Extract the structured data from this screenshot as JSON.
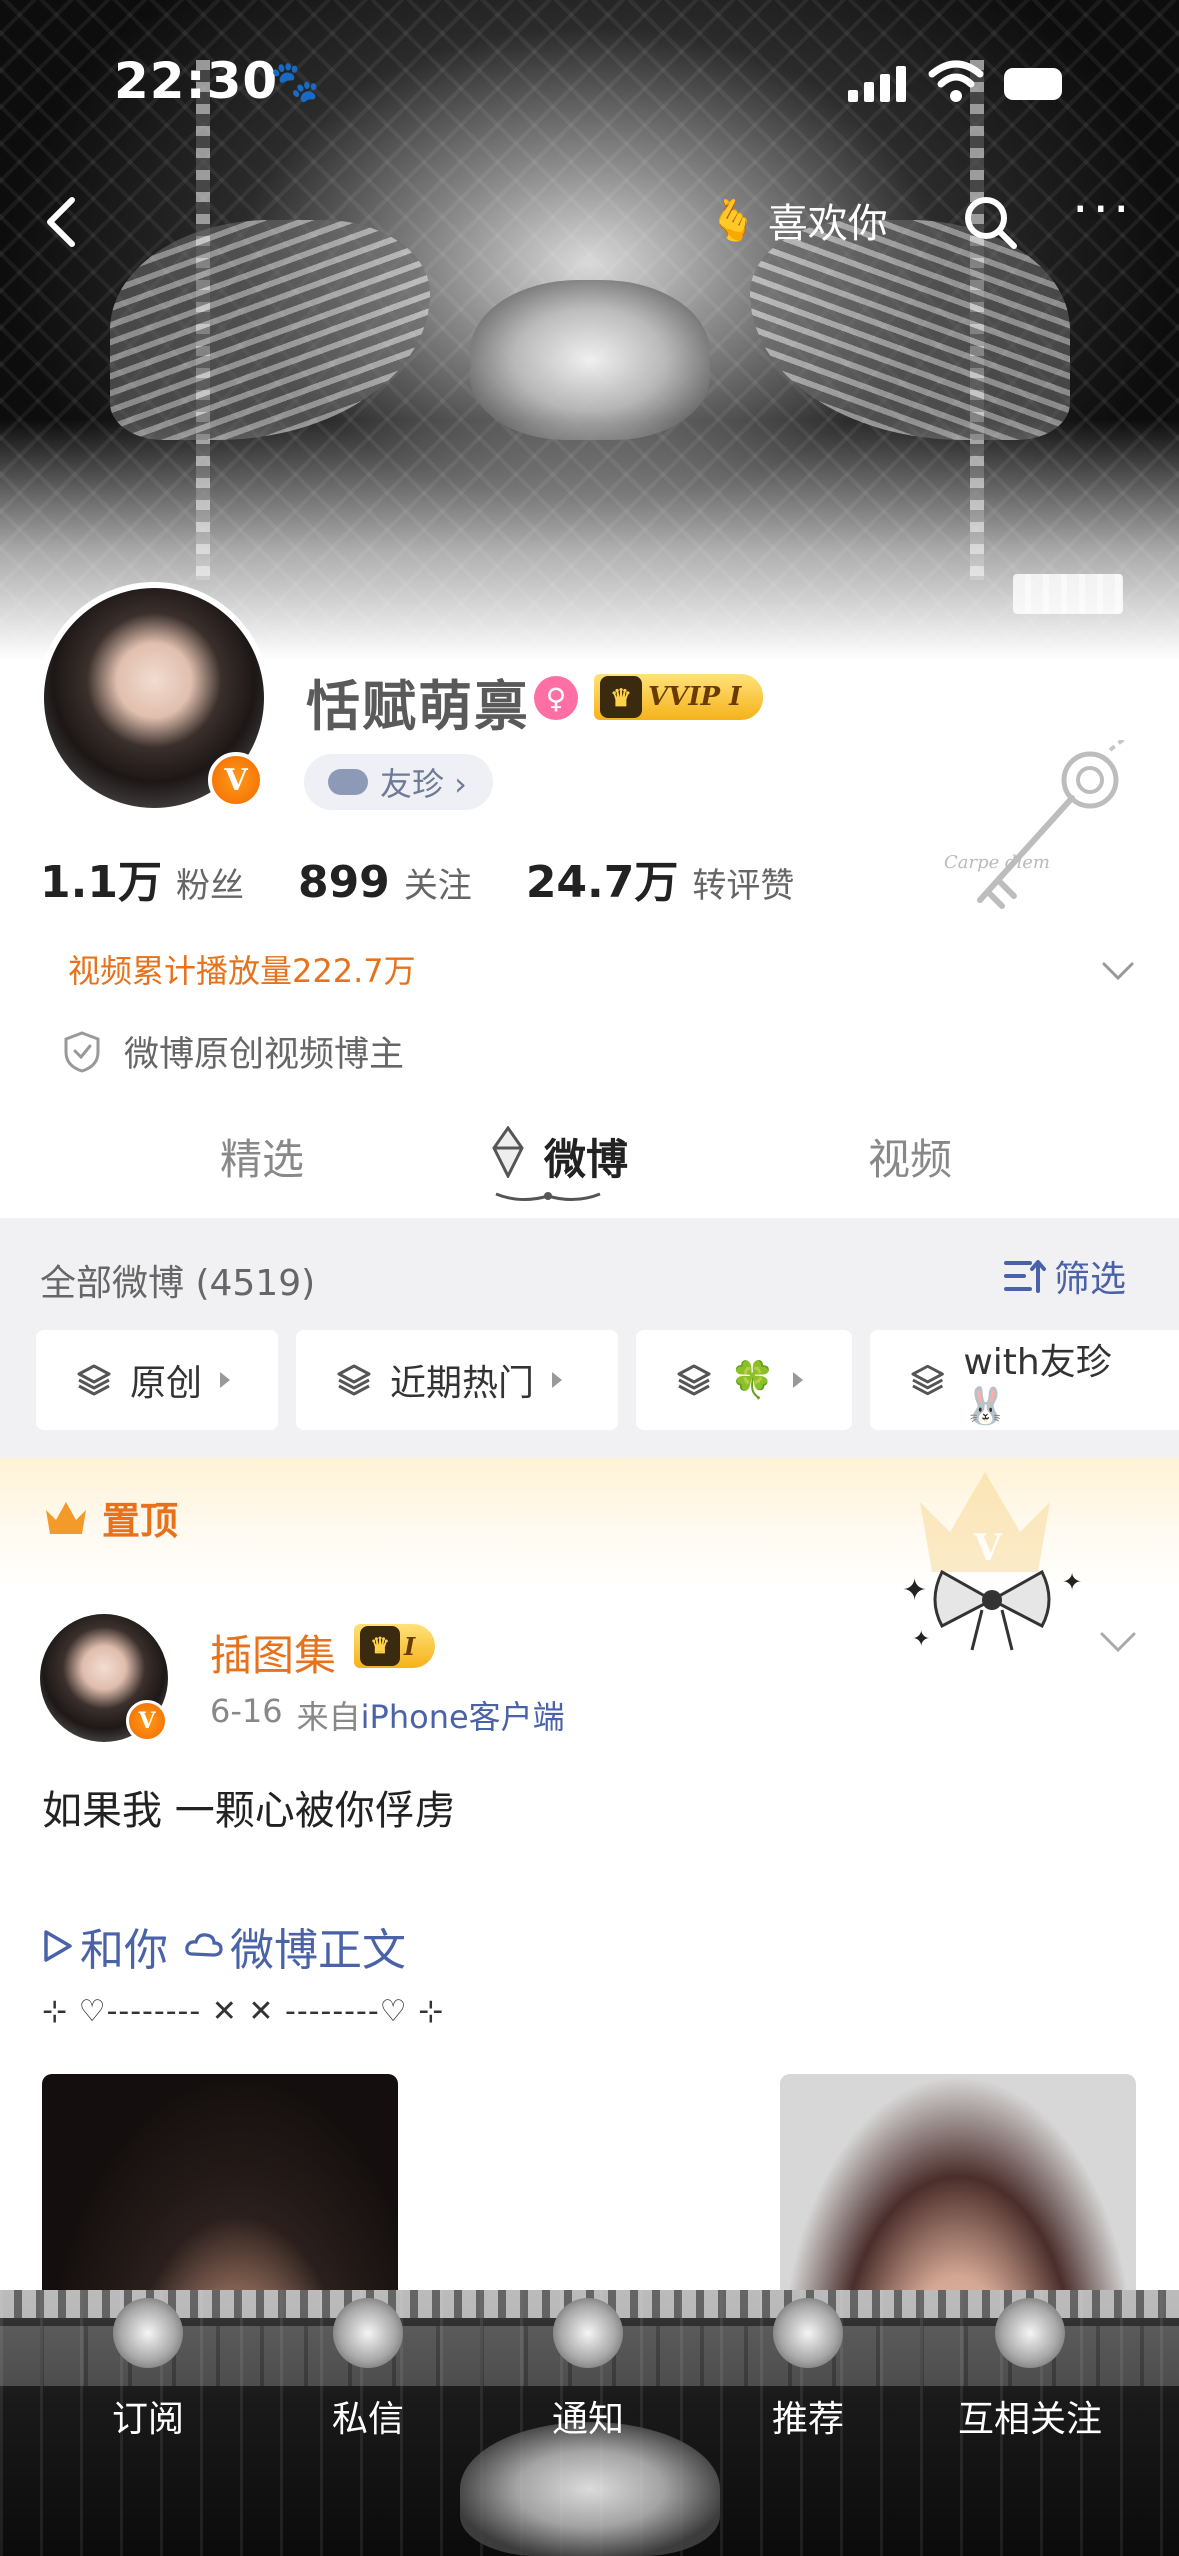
{
  "status_bar": {
    "time": "22:30"
  },
  "nav": {
    "like_label": "喜欢你"
  },
  "profile": {
    "username": "恬赋萌禀",
    "vip_label": "VVIP I",
    "fan_group": "友珍 ›",
    "stats": [
      {
        "value": "1.1万",
        "label": "粉丝"
      },
      {
        "value": "899",
        "label": "关注"
      },
      {
        "value": "24.7万",
        "label": "转评赞"
      }
    ],
    "video_views": "视频累计播放量222.7万",
    "certification": "微博原创视频博主",
    "deco_text": "Carpe diem"
  },
  "tabs": [
    {
      "label": "精选",
      "active": false
    },
    {
      "label": "微博",
      "active": true
    },
    {
      "label": "视频",
      "active": false
    }
  ],
  "feed": {
    "all_count": "全部微博 (4519)",
    "filter_label": "筛选",
    "chips": [
      {
        "label": "原创"
      },
      {
        "label": "近期热门"
      },
      {
        "label": "🍀"
      },
      {
        "label": "with友珍🐰"
      }
    ]
  },
  "pinned": {
    "label": "置顶"
  },
  "post": {
    "author": "插图集",
    "medal": "I",
    "date": "6-16",
    "source_prefix": "来自",
    "source": "iPhone客户端",
    "text": "如果我 一颗心被你俘虏",
    "links": [
      {
        "icon": "play-icon",
        "label": "和你"
      },
      {
        "icon": "weibo-icon",
        "label": "微博正文"
      }
    ],
    "deco_line": "⊹ ♡-------- ✕ ✕ --------♡ ⊹"
  },
  "tabbar": [
    {
      "label": "订阅",
      "icon": "subscribe-icon"
    },
    {
      "label": "私信",
      "icon": "message-icon"
    },
    {
      "label": "通知",
      "icon": "notification-icon"
    },
    {
      "label": "推荐",
      "icon": "recommend-icon"
    },
    {
      "label": "互相关注",
      "icon": "mutual-follow-icon"
    }
  ],
  "colors": {
    "accent_orange": "#e8721c",
    "link_blue": "#4a63a8",
    "vip_gold": "#f5b21a"
  }
}
